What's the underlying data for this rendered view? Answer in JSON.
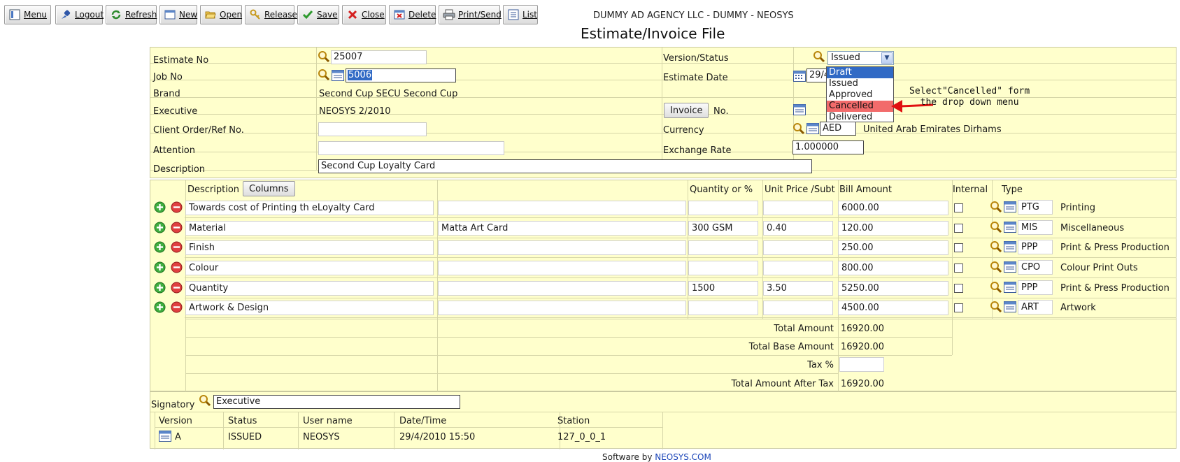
{
  "toolbar": {
    "buttons": [
      {
        "label": "Menu",
        "icon": "menu-icon"
      },
      {
        "label": "Logout",
        "icon": "logout-icon"
      },
      {
        "label": "Refresh",
        "icon": "refresh-icon"
      },
      {
        "label": "New",
        "icon": "new-icon"
      },
      {
        "label": "Open",
        "icon": "open-folder-icon"
      },
      {
        "label": "Release",
        "icon": "key-icon"
      },
      {
        "label": "Save",
        "icon": "checkmark-icon"
      },
      {
        "label": "Close",
        "icon": "close-icon"
      },
      {
        "label": "Delete",
        "icon": "delete-icon"
      },
      {
        "label": "Print/Send",
        "icon": "printer-icon"
      },
      {
        "label": "List",
        "icon": "list-icon"
      }
    ]
  },
  "header": {
    "agency": "DUMMY AD AGENCY LLC - DUMMY - NEOSYS",
    "title": "Estimate/Invoice File"
  },
  "form": {
    "estimate_no_label": "Estimate No",
    "estimate_no": "25007",
    "job_no_label": "Job No",
    "job_no": "5006",
    "brand_label": "Brand",
    "brand": "Second Cup  SECU  Second Cup",
    "executive_label": "Executive",
    "executive": "NEOSYS  2/2010",
    "client_order_label": "Client Order/Ref No.",
    "client_order": "",
    "attention_label": "Attention",
    "attention": "",
    "description_label": "Description",
    "description": "Second Cup Loyalty Card",
    "version_status_label": "Version/Status",
    "status_selected": "Issued",
    "status_options": [
      "Draft",
      "Issued",
      "Approved",
      "Cancelled",
      "Delivered"
    ],
    "estimate_date_label": "Estimate Date",
    "estimate_date": "29/4",
    "invoice_button": "Invoice",
    "invoice_no_label": "No.",
    "currency_label": "Currency",
    "currency_code": "AED",
    "currency_name": "United Arab Emirates Dirhams",
    "exchange_rate_label": "Exchange Rate",
    "exchange_rate": "1.000000"
  },
  "annotation": {
    "line1": "Select\"Cancelled\" form",
    "line2": "  the drop down menu",
    "color": "#e01010"
  },
  "lines": {
    "columns": {
      "description": "Description",
      "columns_button": "Columns",
      "quantity": "Quantity or %",
      "unit_price": "Unit Price /Subt",
      "bill_amount": "Bill Amount",
      "internal": "Internal",
      "type": "Type"
    },
    "rows": [
      {
        "description": "Towards cost of Printing th eLoyalty Card",
        "detail": "",
        "quantity": "",
        "unit_price": "",
        "amount": "6000.00",
        "type_code": "PTG",
        "type_name": "Printing"
      },
      {
        "description": "Material",
        "detail": "Matta Art Card",
        "quantity": "300 GSM",
        "unit_price": "0.40",
        "amount": "120.00",
        "type_code": "MIS",
        "type_name": "Miscellaneous"
      },
      {
        "description": "Finish",
        "detail": "",
        "quantity": "",
        "unit_price": "",
        "amount": "250.00",
        "type_code": "PPP",
        "type_name": "Print & Press Production"
      },
      {
        "description": "Colour",
        "detail": "",
        "quantity": "",
        "unit_price": "",
        "amount": "800.00",
        "type_code": "CPO",
        "type_name": "Colour Print Outs"
      },
      {
        "description": "Quantity",
        "detail": "",
        "quantity": "1500",
        "unit_price": "3.50",
        "amount": "5250.00",
        "type_code": "PPP",
        "type_name": "Print & Press Production"
      },
      {
        "description": "Artwork & Design",
        "detail": "",
        "quantity": "",
        "unit_price": "",
        "amount": "4500.00",
        "type_code": "ART",
        "type_name": "Artwork"
      }
    ],
    "totals": {
      "total_amount_label": "Total Amount",
      "total_amount": "16920.00",
      "total_base_label": "Total Base Amount",
      "total_base": "16920.00",
      "tax_label": "Tax %",
      "tax": "",
      "after_tax_label": "Total Amount After Tax",
      "after_tax": "16920.00"
    }
  },
  "signatory": {
    "label": "Signatory",
    "value": "Executive"
  },
  "versions": {
    "headers": [
      "Version",
      "Status",
      "User name",
      "Date/Time",
      "Station"
    ],
    "rows": [
      {
        "version": "A",
        "status": "ISSUED",
        "user": "NEOSYS",
        "datetime": "29/4/2010 15:50",
        "station": "127_0_0_1"
      }
    ]
  },
  "footer": {
    "prefix": "Software by ",
    "link": "NEOSYS.COM"
  }
}
